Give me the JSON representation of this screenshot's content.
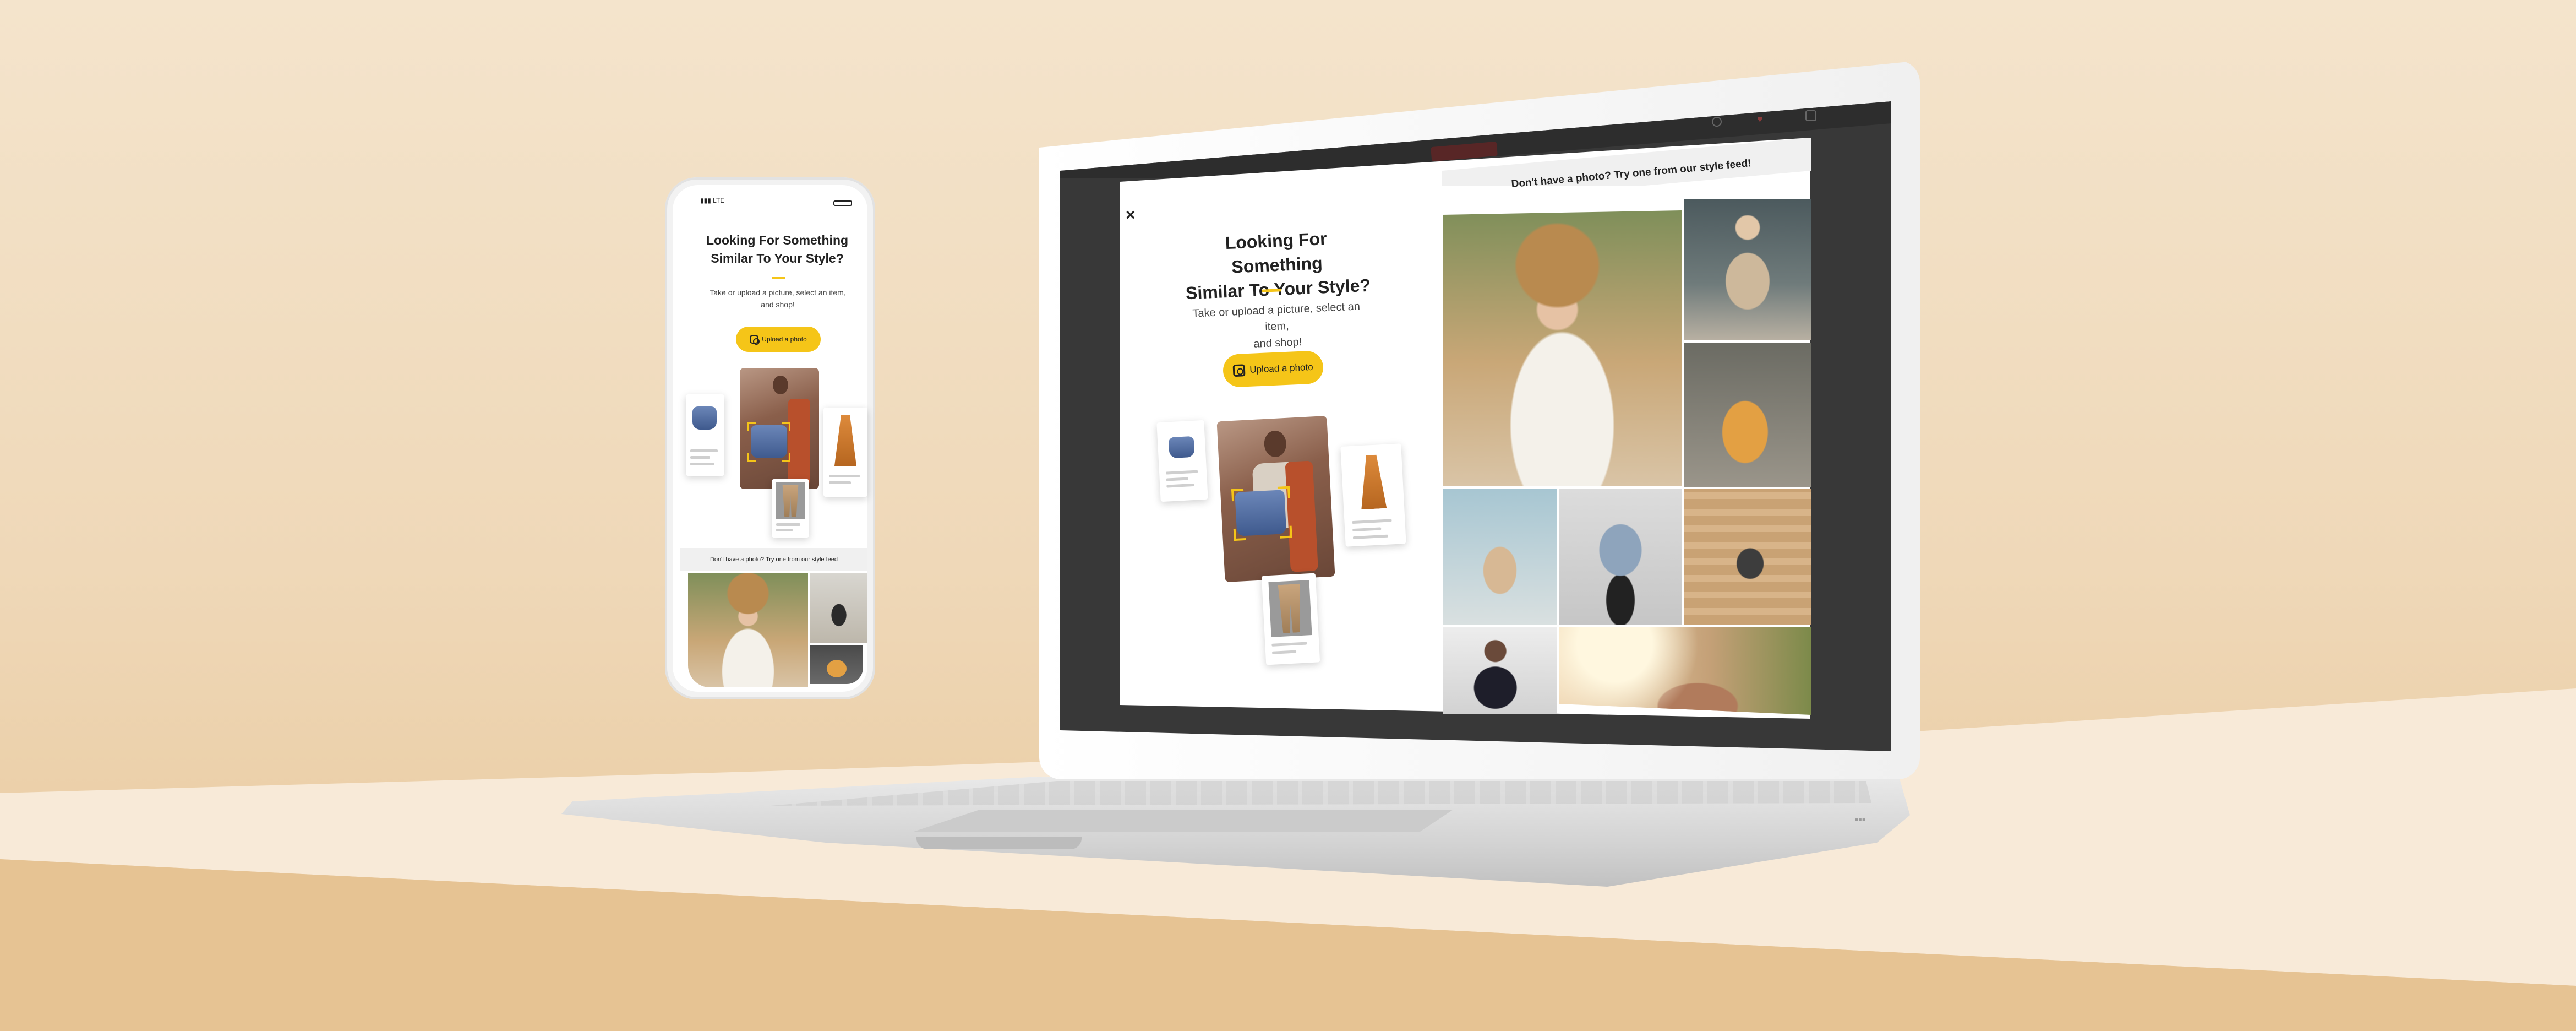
{
  "modal": {
    "close_label": "×",
    "title_line1": "Looking For Something",
    "title_line2": "Similar To Your Style?",
    "subtitle_line1": "Take or upload a picture, select an item,",
    "subtitle_line2": "and shop!",
    "upload_label": "Upload a photo"
  },
  "feed": {
    "title": "Don't have a photo? Try one from our style feed!"
  },
  "phone": {
    "status_network": "LTE",
    "title_line1": "Looking For Something",
    "title_line2": "Similar To Your Style?",
    "subtitle_line1": "Take or upload a picture, select an item,",
    "subtitle_line2": "and shop!",
    "upload_label": "Upload a photo",
    "feed_title": "Don't have a photo? Try one from our style feed"
  },
  "colors": {
    "accent": "#f5c518",
    "screen_bg": "#383838",
    "modal_bg": "#ffffff",
    "backdrop": "#f4e4cc"
  }
}
